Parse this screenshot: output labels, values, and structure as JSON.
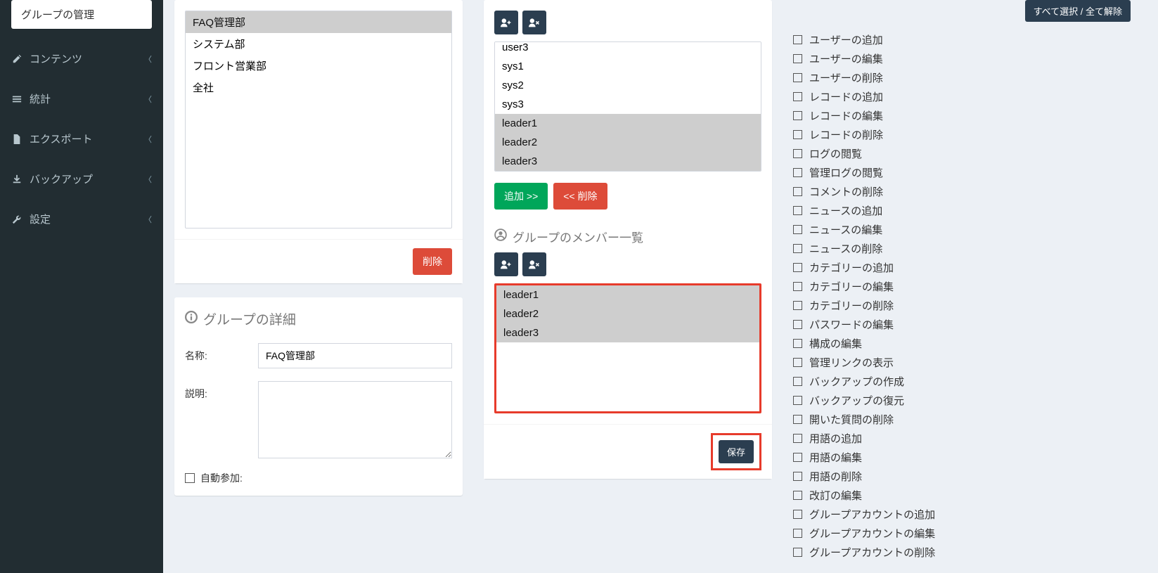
{
  "sidebar": {
    "active": "グループの管理",
    "items": [
      {
        "icon": "edit-icon",
        "label": "コンテンツ"
      },
      {
        "icon": "bars-icon",
        "label": "統計"
      },
      {
        "icon": "file-icon",
        "label": "エクスポート"
      },
      {
        "icon": "download-icon",
        "label": "バックアップ"
      },
      {
        "icon": "wrench-icon",
        "label": "設定"
      }
    ]
  },
  "groupList": {
    "options": [
      "FAQ管理部",
      "システム部",
      "フロント営業部",
      "全社"
    ],
    "selected": [
      "FAQ管理部"
    ],
    "deleteBtn": "削除"
  },
  "groupDetail": {
    "title": "グループの詳細",
    "nameLabel": "名称:",
    "nameValue": "FAQ管理部",
    "descLabel": "説明:",
    "descValue": "",
    "autoJoinLabel": "自動参加:"
  },
  "userPicker": {
    "options": [
      "user3",
      "sys1",
      "sys2",
      "sys3",
      "leader1",
      "leader2",
      "leader3"
    ],
    "selected": [
      "leader1",
      "leader2",
      "leader3"
    ],
    "addBtn": "追加 >>",
    "removeBtn": "<< 削除"
  },
  "memberList": {
    "title": "グループのメンバー一覧",
    "options": [
      "leader1",
      "leader2",
      "leader3"
    ],
    "selected": [
      "leader1",
      "leader2",
      "leader3"
    ],
    "saveBtn": "保存"
  },
  "permissions": {
    "toggleAll": "すべて選択 / 全て解除",
    "items": [
      "ユーザーの追加",
      "ユーザーの編集",
      "ユーザーの削除",
      "レコードの追加",
      "レコードの編集",
      "レコードの削除",
      "ログの閲覧",
      "管理ログの閲覧",
      "コメントの削除",
      "ニュースの追加",
      "ニュースの編集",
      "ニュースの削除",
      "カテゴリーの追加",
      "カテゴリーの編集",
      "カテゴリーの削除",
      "パスワードの編集",
      "構成の編集",
      "管理リンクの表示",
      "バックアップの作成",
      "バックアップの復元",
      "開いた質問の削除",
      "用語の追加",
      "用語の編集",
      "用語の削除",
      "改訂の編集",
      "グループアカウントの追加",
      "グループアカウントの編集",
      "グループアカウントの削除"
    ]
  }
}
